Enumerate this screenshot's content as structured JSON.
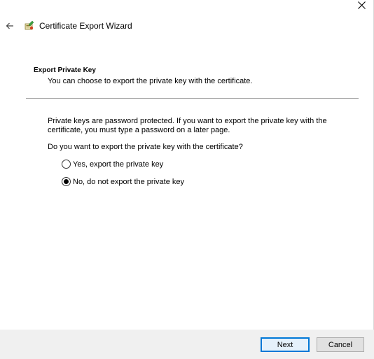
{
  "window": {
    "title": "Certificate Export Wizard"
  },
  "icons": {
    "close": "close-icon",
    "back": "back-arrow-icon",
    "app": "certificate-wizard-icon"
  },
  "section": {
    "title": "Export Private Key",
    "description": "You can choose to export the private key with the certificate."
  },
  "body": {
    "info": "Private keys are password protected. If you want to export the private key with the certificate, you must type a password on a later page.",
    "question": "Do you want to export the private key with the certificate?"
  },
  "options": [
    {
      "label": "Yes, export the private key",
      "selected": false
    },
    {
      "label": "No, do not export the private key",
      "selected": true
    }
  ],
  "buttons": {
    "next": "Next",
    "cancel": "Cancel"
  },
  "colors": {
    "accent": "#0078d7",
    "footer": "#f0f0f0",
    "divider": "#a0a0a0"
  }
}
